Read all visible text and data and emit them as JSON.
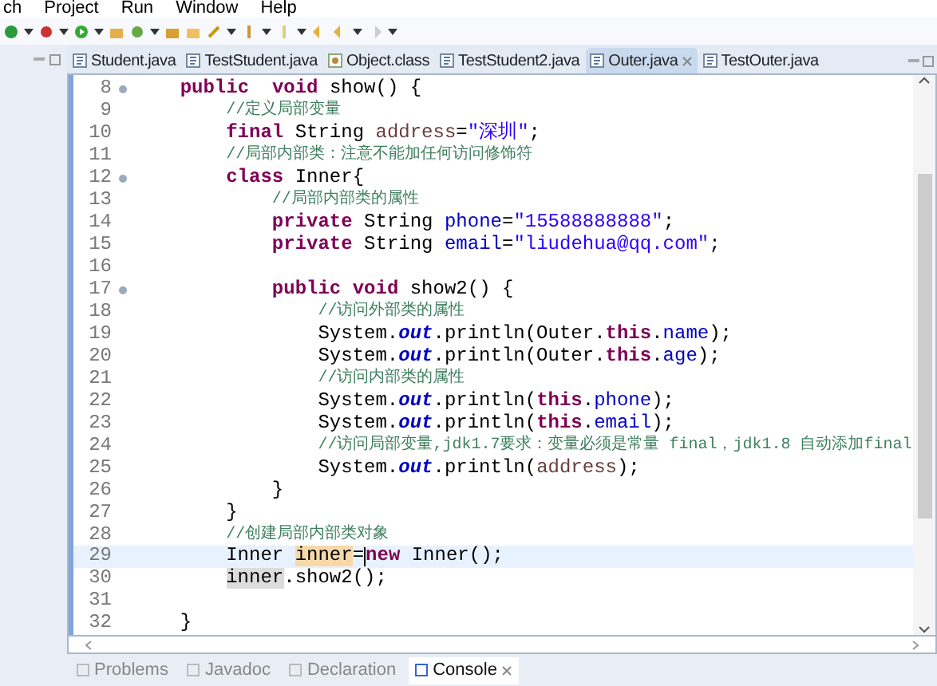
{
  "menu": [
    "ch",
    "Project",
    "Run",
    "Window",
    "Help"
  ],
  "editor_tabs": [
    {
      "label": "Student.java",
      "selected": false,
      "kind": "java"
    },
    {
      "label": "TestStudent.java",
      "selected": false,
      "kind": "java"
    },
    {
      "label": "Object.class",
      "selected": false,
      "kind": "class"
    },
    {
      "label": "TestStudent2.java",
      "selected": false,
      "kind": "java"
    },
    {
      "label": "Outer.java",
      "selected": true,
      "kind": "java"
    },
    {
      "label": "TestOuter.java",
      "selected": false,
      "kind": "java"
    }
  ],
  "code_lines": [
    {
      "number": "8",
      "fold": true,
      "current": false,
      "tokens": [
        {
          "kind": "keyword",
          "text": "    public"
        },
        {
          "kind": "keyword",
          "text": "  void"
        },
        {
          "kind": "plain",
          "text": " show() {"
        }
      ]
    },
    {
      "number": "9",
      "fold": false,
      "current": false,
      "tokens": [
        {
          "kind": "comment",
          "text": "        //定义局部变量"
        }
      ]
    },
    {
      "number": "10",
      "fold": false,
      "current": false,
      "tokens": [
        {
          "kind": "keyword",
          "text": "        final"
        },
        {
          "kind": "plain",
          "text": " String "
        },
        {
          "kind": "local",
          "text": "address"
        },
        {
          "kind": "plain",
          "text": "="
        },
        {
          "kind": "string",
          "text": "\"深圳\""
        },
        {
          "kind": "plain",
          "text": ";"
        }
      ]
    },
    {
      "number": "11",
      "fold": false,
      "current": false,
      "tokens": [
        {
          "kind": "comment",
          "text": "        //局部内部类：注意不能加任何访问修饰符"
        }
      ]
    },
    {
      "number": "12",
      "fold": true,
      "current": false,
      "tokens": [
        {
          "kind": "keyword",
          "text": "        class"
        },
        {
          "kind": "plain",
          "text": " Inner{"
        }
      ]
    },
    {
      "number": "13",
      "fold": false,
      "current": false,
      "tokens": [
        {
          "kind": "comment",
          "text": "            //局部内部类的属性"
        }
      ]
    },
    {
      "number": "14",
      "fold": false,
      "current": false,
      "tokens": [
        {
          "kind": "keyword",
          "text": "            private"
        },
        {
          "kind": "plain",
          "text": " String "
        },
        {
          "kind": "field",
          "text": "phone"
        },
        {
          "kind": "plain",
          "text": "="
        },
        {
          "kind": "string",
          "text": "\"15588888888\""
        },
        {
          "kind": "plain",
          "text": ";"
        }
      ]
    },
    {
      "number": "15",
      "fold": false,
      "current": false,
      "tokens": [
        {
          "kind": "keyword",
          "text": "            private"
        },
        {
          "kind": "plain",
          "text": " String "
        },
        {
          "kind": "field",
          "text": "email"
        },
        {
          "kind": "plain",
          "text": "="
        },
        {
          "kind": "string",
          "text": "\"liudehua@qq.com\""
        },
        {
          "kind": "plain",
          "text": ";"
        }
      ]
    },
    {
      "number": "16",
      "fold": false,
      "current": false
    },
    {
      "number": "17",
      "fold": true,
      "current": false,
      "tokens": [
        {
          "kind": "keyword",
          "text": "            public"
        },
        {
          "kind": "keyword",
          "text": " void"
        },
        {
          "kind": "plain",
          "text": " show2() {"
        }
      ]
    },
    {
      "number": "18",
      "fold": false,
      "current": false,
      "tokens": [
        {
          "kind": "comment",
          "text": "                //访问外部类的属性"
        }
      ]
    },
    {
      "number": "19",
      "fold": false,
      "current": false,
      "tokens": [
        {
          "kind": "plain",
          "text": "                System."
        },
        {
          "kind": "static",
          "text": "out"
        },
        {
          "kind": "plain",
          "text": ".println(Outer."
        },
        {
          "kind": "keyword",
          "text": "this"
        },
        {
          "kind": "plain",
          "text": "."
        },
        {
          "kind": "field",
          "text": "name"
        },
        {
          "kind": "plain",
          "text": ");"
        }
      ]
    },
    {
      "number": "20",
      "fold": false,
      "current": false,
      "tokens": [
        {
          "kind": "plain",
          "text": "                System."
        },
        {
          "kind": "static",
          "text": "out"
        },
        {
          "kind": "plain",
          "text": ".println(Outer."
        },
        {
          "kind": "keyword",
          "text": "this"
        },
        {
          "kind": "plain",
          "text": "."
        },
        {
          "kind": "field",
          "text": "age"
        },
        {
          "kind": "plain",
          "text": ");"
        }
      ]
    },
    {
      "number": "21",
      "fold": false,
      "current": false,
      "tokens": [
        {
          "kind": "comment",
          "text": "                //访问内部类的属性"
        }
      ]
    },
    {
      "number": "22",
      "fold": false,
      "current": false,
      "tokens": [
        {
          "kind": "plain",
          "text": "                System."
        },
        {
          "kind": "static",
          "text": "out"
        },
        {
          "kind": "plain",
          "text": ".println("
        },
        {
          "kind": "keyword",
          "text": "this"
        },
        {
          "kind": "plain",
          "text": "."
        },
        {
          "kind": "field",
          "text": "phone"
        },
        {
          "kind": "plain",
          "text": ");"
        }
      ]
    },
    {
      "number": "23",
      "fold": false,
      "current": false,
      "tokens": [
        {
          "kind": "plain",
          "text": "                System."
        },
        {
          "kind": "static",
          "text": "out"
        },
        {
          "kind": "plain",
          "text": ".println("
        },
        {
          "kind": "keyword",
          "text": "this"
        },
        {
          "kind": "plain",
          "text": "."
        },
        {
          "kind": "field",
          "text": "email"
        },
        {
          "kind": "plain",
          "text": ");"
        }
      ]
    },
    {
      "number": "24",
      "fold": false,
      "current": false,
      "tokens": [
        {
          "kind": "comment",
          "text": "                //访问局部变量,jdk1.7要求：变量必须是常量 final，jdk1.8 自动添加final"
        }
      ]
    },
    {
      "number": "25",
      "fold": false,
      "current": false,
      "tokens": [
        {
          "kind": "plain",
          "text": "                System."
        },
        {
          "kind": "static",
          "text": "out"
        },
        {
          "kind": "plain",
          "text": ".println("
        },
        {
          "kind": "local",
          "text": "address"
        },
        {
          "kind": "plain",
          "text": ");"
        }
      ]
    },
    {
      "number": "26",
      "fold": false,
      "current": false,
      "tokens": [
        {
          "kind": "plain",
          "text": "            }"
        }
      ]
    },
    {
      "number": "27",
      "fold": false,
      "current": false,
      "tokens": [
        {
          "kind": "plain",
          "text": "        }"
        }
      ]
    },
    {
      "number": "28",
      "fold": false,
      "current": false,
      "tokens": [
        {
          "kind": "comment",
          "text": "        //创建局部内部类对象"
        }
      ]
    },
    {
      "number": "29",
      "fold": false,
      "current": true,
      "tokens": [
        {
          "kind": "plain",
          "text": "        Inner "
        },
        {
          "kind": "write",
          "text": "inner"
        },
        {
          "kind": "plain",
          "text": "="
        },
        {
          "kind": "caret"
        },
        {
          "kind": "keyword",
          "text": "new"
        },
        {
          "kind": "plain",
          "text": " Inner();"
        }
      ]
    },
    {
      "number": "30",
      "fold": false,
      "current": false,
      "tokens": [
        {
          "kind": "read",
          "text": "        inner"
        },
        {
          "kind": "plain",
          "text": ".show2();"
        }
      ]
    },
    {
      "number": "31",
      "fold": false,
      "current": false
    },
    {
      "number": "32",
      "fold": false,
      "current": false,
      "tokens": [
        {
          "kind": "plain",
          "text": "    }"
        }
      ]
    }
  ],
  "bottom_tabs": [
    {
      "label": "Problems",
      "selected": false
    },
    {
      "label": "Javadoc",
      "selected": false
    },
    {
      "label": "Declaration",
      "selected": false
    },
    {
      "label": "Console",
      "selected": true
    }
  ]
}
